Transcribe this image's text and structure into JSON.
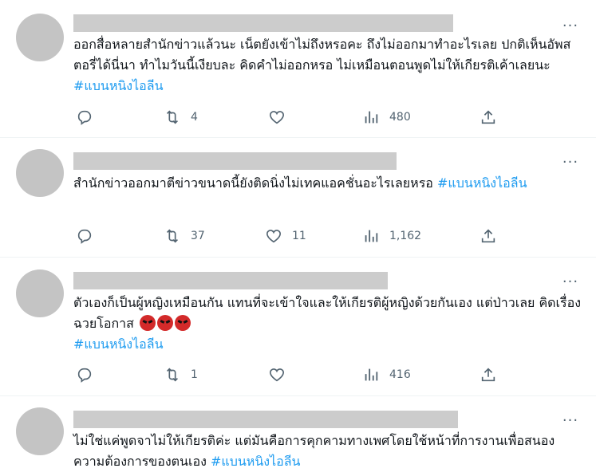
{
  "tweets": [
    {
      "text": "ออกสื่อหลายสำนักข่าวแล้วนะ เน็ตยังเข้าไม่ถึงหรอคะ ถึงไม่ออกมาทำอะไรเลย ปกติเห็นอัพสตอรี่ได้นี่นา ทำไมวันนี้เงียบละ คิดคำไม่ออกหรอ ไม่เหมือนตอนพูดไม่ให้เกียรติเค้าเลยนะ",
      "hashtag": "#แบนหนิงไอลีน",
      "replies": "",
      "retweets": "4",
      "likes": "",
      "views": "480"
    },
    {
      "text": "สำนักข่าวออกมาตีข่าวขนาดนี้ยังติดนิ่งไม่เทคแอคชั่นอะไรเลยหรอ",
      "hashtag": "#แบนหนิงไอลีน",
      "replies": "",
      "retweets": "37",
      "likes": "11",
      "views": "1,162"
    },
    {
      "text": "ตัวเองก็เป็นผู้หญิงเหมือนกัน แทนที่จะเข้าใจและให้เกียรติผู้หญิงด้วยกันเอง แต่ป่าวเลย คิดเรื่องฉวยโอกาส",
      "emoji": "angry-face",
      "hashtag": "#แบนหนิงไอลีน",
      "replies": "",
      "retweets": "1",
      "likes": "",
      "views": "416"
    },
    {
      "text": "ไม่ใช่แค่พูดจาไม่ให้เกียรติค่ะ แต่มันคือการคุกคามทางเพศโดยใช้หน้าที่การงานเพื่อสนองความต้องการของตนเอง",
      "hashtag": "#แบนหนิงไอลีน"
    }
  ],
  "colors": {
    "hashtag": "#1d9bf0",
    "icon": "#536471",
    "placeholder": "#c4c4c4"
  },
  "icons": [
    "reply-icon",
    "retweet-icon",
    "like-icon",
    "views-icon",
    "share-icon",
    "more-icon"
  ]
}
